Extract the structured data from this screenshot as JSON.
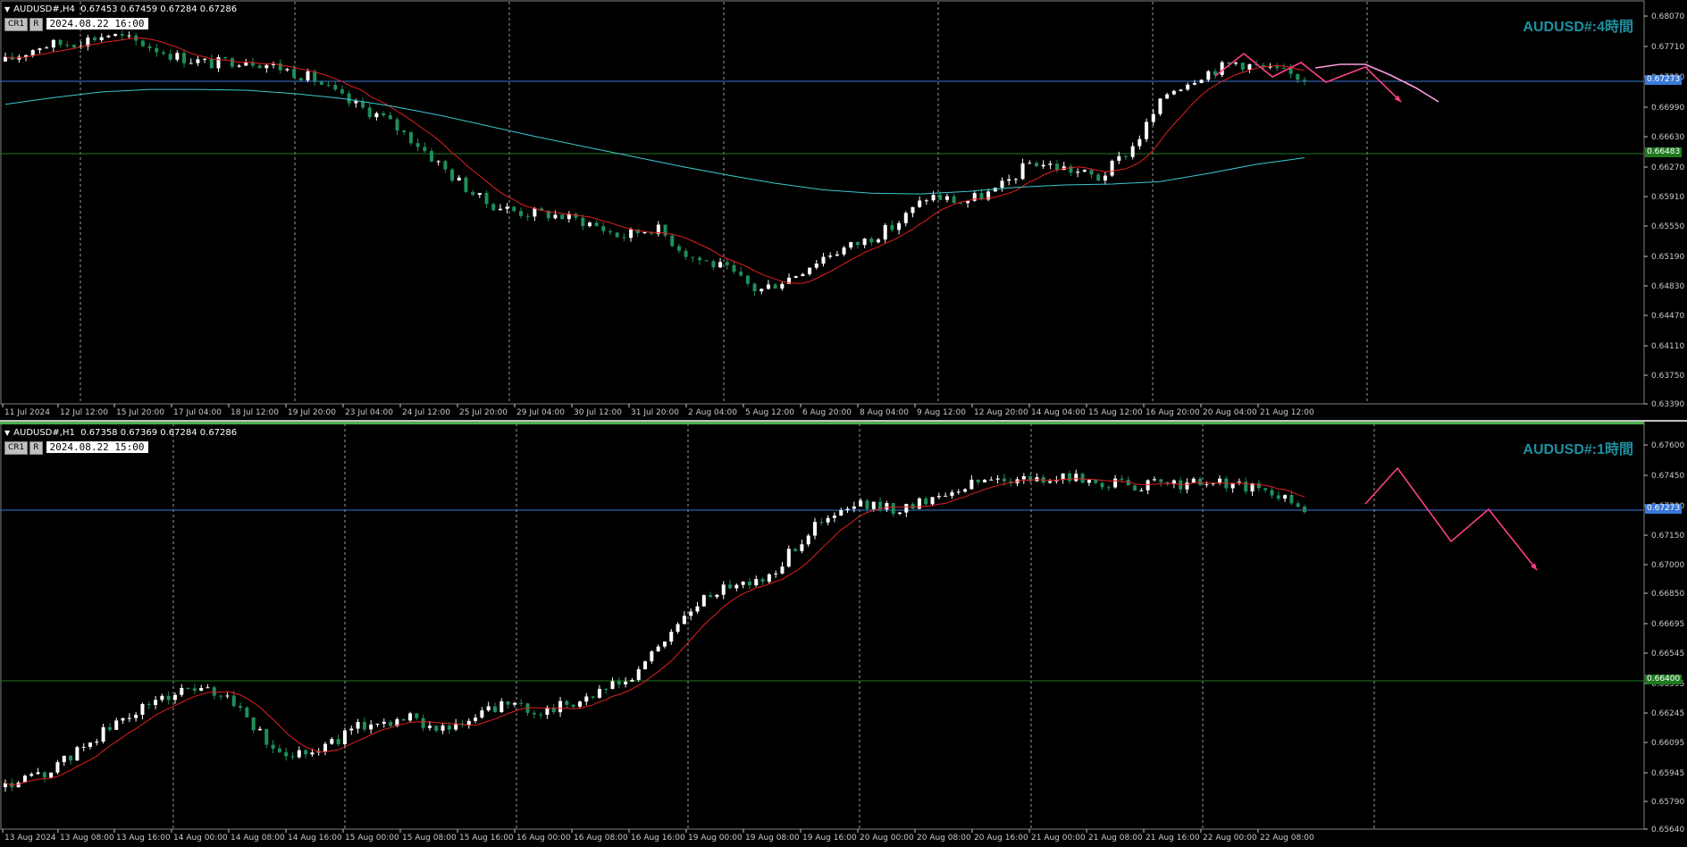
{
  "top": {
    "header": {
      "symbol": "AUDUSD#,H4",
      "ohlc": "0.67453 0.67459 0.67284 0.67286",
      "badges": [
        "CR1",
        "R"
      ],
      "date": "2024.08.22 16:00"
    },
    "title": "AUDUSD#:4時間",
    "current_price_label": "0.67273",
    "level_price_label": "0.66483",
    "y_ticks": [
      "0.68070",
      "0.67710",
      "0.67350",
      "0.66990",
      "0.66630",
      "0.66270",
      "0.65910",
      "0.65550",
      "0.65190",
      "0.64830",
      "0.64470",
      "0.64110",
      "0.63750",
      "0.63390"
    ],
    "x_ticks": [
      "11 Jul 2024",
      "12 Jul 12:00",
      "15 Jul 20:00",
      "17 Jul 04:00",
      "18 Jul 12:00",
      "19 Jul 20:00",
      "23 Jul 04:00",
      "24 Jul 12:00",
      "25 Jul 20:00",
      "29 Jul 04:00",
      "30 Jul 12:00",
      "31 Jul 20:00",
      "2 Aug 04:00",
      "5 Aug 12:00",
      "6 Aug 20:00",
      "8 Aug 04:00",
      "9 Aug 12:00",
      "12 Aug 20:00",
      "14 Aug 04:00",
      "15 Aug 12:00",
      "16 Aug 20:00",
      "20 Aug 04:00",
      "21 Aug 12:00"
    ]
  },
  "bottom": {
    "header": {
      "symbol": "AUDUSD#,H1",
      "ohlc": "0.67358 0.67369 0.67284 0.67286",
      "badges": [
        "CR1",
        "R"
      ],
      "date": "2024.08.22 15:00"
    },
    "title": "AUDUSD#:1時間",
    "current_price_label": "0.67273",
    "level_price_label": "0.66400",
    "y_ticks": [
      "0.67600",
      "0.67450",
      "0.67300",
      "0.67150",
      "0.67000",
      "0.66850",
      "0.66695",
      "0.66545",
      "0.66395",
      "0.66245",
      "0.66095",
      "0.65945",
      "0.65790",
      "0.65640"
    ],
    "x_ticks": [
      "13 Aug 2024",
      "13 Aug 08:00",
      "13 Aug 16:00",
      "14 Aug 00:00",
      "14 Aug 08:00",
      "14 Aug 16:00",
      "15 Aug 00:00",
      "15 Aug 08:00",
      "15 Aug 16:00",
      "16 Aug 00:00",
      "16 Aug 08:00",
      "16 Aug 16:00",
      "19 Aug 00:00",
      "19 Aug 08:00",
      "19 Aug 16:00",
      "20 Aug 00:00",
      "20 Aug 08:00",
      "20 Aug 16:00",
      "21 Aug 00:00",
      "21 Aug 08:00",
      "21 Aug 16:00",
      "22 Aug 00:00",
      "22 Aug 08:00"
    ]
  },
  "colors": {
    "background": "#000000",
    "bull": "#ffffff",
    "bear": "#1e8f5a",
    "ma_fast": "#e02020",
    "ma_slow": "#3cc8d0",
    "current_line": "#3a78d8",
    "level_line": "#1f7a1f",
    "forecast": "#ff3e8a",
    "title": "#1e90a0"
  },
  "chart_data": [
    {
      "type": "line",
      "series": [
        {
          "values": [
            0.6749,
            0.6768,
            0.6772,
            0.6782,
            0.6771,
            0.6755,
            0.6746,
            0.6752,
            0.6742,
            0.6728,
            0.67,
            0.6682,
            0.6651,
            0.6612,
            0.6578,
            0.6566,
            0.6563,
            0.6554,
            0.6536,
            0.6548,
            0.6513,
            0.6498,
            0.647,
            0.6488,
            0.6514,
            0.6529,
            0.6549,
            0.6586,
            0.6578,
            0.6592,
            0.6627,
            0.6619,
            0.6607,
            0.6647,
            0.6712,
            0.6734,
            0.6748,
            0.6738,
            0.6729
          ]
        }
      ],
      "ylim": [
        0.6333,
        0.6815
      ]
    },
    {
      "type": "line",
      "series": [
        {
          "values": [
            0.6582,
            0.659,
            0.6608,
            0.6623,
            0.6634,
            0.663,
            0.66,
            0.6602,
            0.6615,
            0.6618,
            0.6612,
            0.6625,
            0.6622,
            0.6629,
            0.6639,
            0.6668,
            0.6688,
            0.6691,
            0.6718,
            0.673,
            0.6728,
            0.6737,
            0.6744,
            0.6743,
            0.6744,
            0.674,
            0.6741,
            0.6742,
            0.6738,
            0.6729
          ]
        }
      ],
      "ylim": [
        0.656,
        0.677
      ]
    }
  ]
}
